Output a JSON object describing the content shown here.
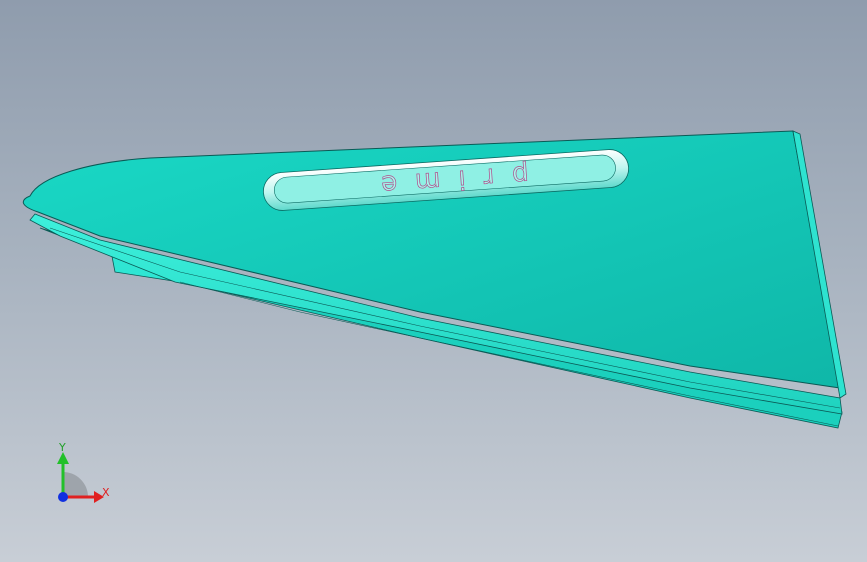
{
  "model": {
    "emboss_text": "prime",
    "part_color": "#1fd8c4",
    "part_top_color": "#14c9b8",
    "edge_color": "#0a5a55"
  },
  "triad": {
    "x_label": "X",
    "y_label": "Y",
    "x_color": "#e02020",
    "y_color": "#22c02a",
    "z_color": "#1030e0"
  }
}
